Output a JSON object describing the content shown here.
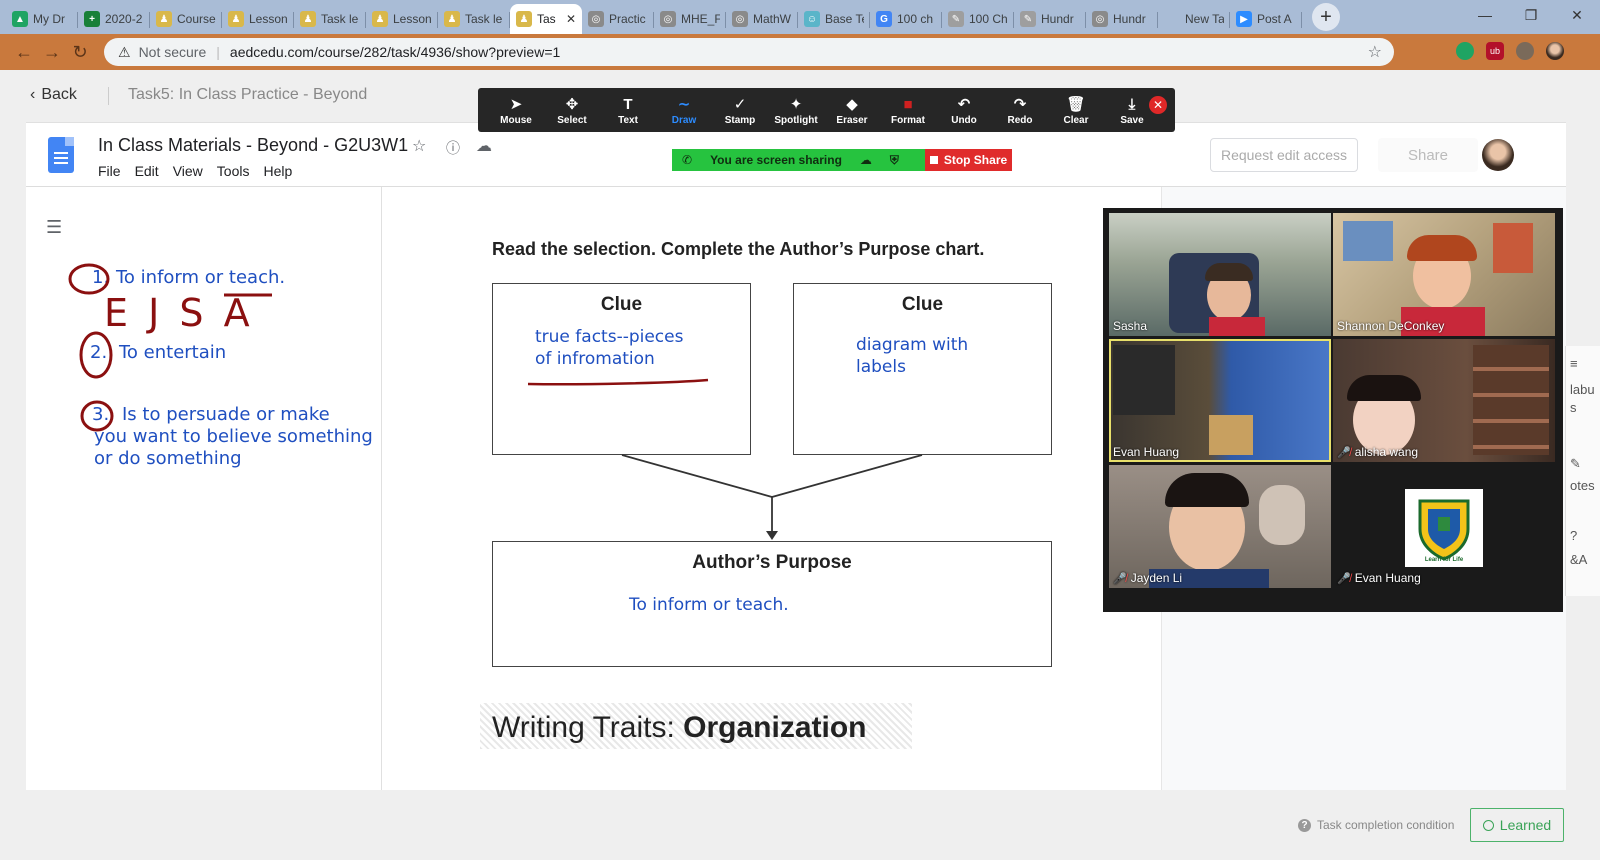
{
  "browser": {
    "tabs": [
      {
        "title": "My Dr",
        "fav_color": "#1fa463",
        "fav_glyph": "▲"
      },
      {
        "title": "2020-2",
        "fav_color": "#188038",
        "fav_glyph": "+"
      },
      {
        "title": "Course",
        "fav_color": "#d9b84a",
        "fav_glyph": "♟"
      },
      {
        "title": "Lesson",
        "fav_color": "#d9b84a",
        "fav_glyph": "♟"
      },
      {
        "title": "Task le",
        "fav_color": "#d9b84a",
        "fav_glyph": "♟"
      },
      {
        "title": "Lesson",
        "fav_color": "#d9b84a",
        "fav_glyph": "♟"
      },
      {
        "title": "Task le",
        "fav_color": "#d9b84a",
        "fav_glyph": "♟"
      },
      {
        "title": "Tas",
        "fav_color": "#d9b84a",
        "fav_glyph": "♟",
        "active": true
      },
      {
        "title": "Practic",
        "fav_color": "#8a8a8a",
        "fav_glyph": "◎"
      },
      {
        "title": "MHE_F",
        "fav_color": "#8a8a8a",
        "fav_glyph": "◎"
      },
      {
        "title": "MathW",
        "fav_color": "#8a8a8a",
        "fav_glyph": "◎"
      },
      {
        "title": "Base Te",
        "fav_color": "#5ab5c9",
        "fav_glyph": "☺"
      },
      {
        "title": "100 ch",
        "fav_color": "#4285f4",
        "fav_glyph": "G"
      },
      {
        "title": "100 Ch",
        "fav_color": "#9e9e9e",
        "fav_glyph": "✎"
      },
      {
        "title": "Hundr",
        "fav_color": "#9e9e9e",
        "fav_glyph": "✎"
      },
      {
        "title": "Hundr",
        "fav_color": "#8a8a8a",
        "fav_glyph": "◎"
      },
      {
        "title": "New Tab",
        "fav_color": "",
        "fav_glyph": ""
      },
      {
        "title": "Post A",
        "fav_color": "#2d8cff",
        "fav_glyph": "▶"
      }
    ],
    "new_tab_glyph": "+",
    "window_controls": [
      "—",
      "❐",
      "✕"
    ],
    "not_secure_label": "Not secure",
    "url": "aedcedu.com/course/282/task/4936/show?preview=1"
  },
  "course": {
    "back_label": "Back",
    "breadcrumb": "Task5:  In Class Practice - Beyond"
  },
  "zoom_toolbar": {
    "tools": [
      {
        "label": "Mouse",
        "glyph": "➤"
      },
      {
        "label": "Select",
        "glyph": "✥"
      },
      {
        "label": "Text",
        "glyph": "T"
      },
      {
        "label": "Draw",
        "glyph": "∼",
        "selected": true
      },
      {
        "label": "Stamp",
        "glyph": "✓"
      },
      {
        "label": "Spotlight",
        "glyph": "✦"
      },
      {
        "label": "Eraser",
        "glyph": "◆"
      },
      {
        "label": "Format",
        "glyph": "■"
      },
      {
        "label": "Undo",
        "glyph": "↶"
      },
      {
        "label": "Redo",
        "glyph": "↷"
      },
      {
        "label": "Clear",
        "glyph": "🗑"
      },
      {
        "label": "Save",
        "glyph": "⤓"
      }
    ]
  },
  "doc": {
    "title": "In Class Materials - Beyond - G2U3W1",
    "menu": [
      "File",
      "Edit",
      "View",
      "Tools",
      "Help"
    ],
    "screen_sharing_label": "You are screen sharing",
    "stop_share_label": "Stop Share",
    "request_edit_label": "Request edit access",
    "share_label": "Share"
  },
  "notes": {
    "line1": "To inform or teach.",
    "num1": "1.",
    "letters": "E  J  S  A",
    "line2": "To entertain",
    "num2": "2.",
    "line3a": "Is to persuade or make",
    "line3b": "you want to believe something",
    "line3c": "or do something",
    "num3": "3."
  },
  "worksheet": {
    "instruction": "Read the selection. Complete the Author’s Purpose chart.",
    "clue1_label": "Clue",
    "clue1_text_a": "true facts--pieces",
    "clue1_text_b": "of infromation",
    "clue2_label": "Clue",
    "clue2_text_a": "diagram with",
    "clue2_text_b": "labels",
    "purpose_label": "Author’s Purpose",
    "purpose_text": "To inform or teach.",
    "traits_plain": "Writing Traits: ",
    "traits_bold": "Organization"
  },
  "gallery": {
    "participants": [
      {
        "name": "Sasha",
        "muted": false,
        "speaking": false
      },
      {
        "name": "Shannon DeConkey",
        "muted": false,
        "speaking": false
      },
      {
        "name": "Evan Huang",
        "muted": false,
        "speaking": true
      },
      {
        "name": "alisha wang",
        "muted": true,
        "speaking": false
      },
      {
        "name": "Jayden Li",
        "muted": true,
        "speaking": false
      },
      {
        "name": "Evan Huang",
        "muted": true,
        "speaking": false
      }
    ],
    "logo_text": "Learn for Life"
  },
  "edge_panel": {
    "item1": "labu",
    "item1b": "s",
    "item2": "otes",
    "item3": "&A"
  },
  "footer": {
    "condition_label": "Task completion condition",
    "learned_label": "Learned"
  },
  "colors": {
    "ink_blue": "#1f4fc0",
    "ink_red": "#8b1010",
    "share_green": "#26c33f",
    "stop_red": "#e02b2b",
    "learned_green": "#3aa357"
  }
}
